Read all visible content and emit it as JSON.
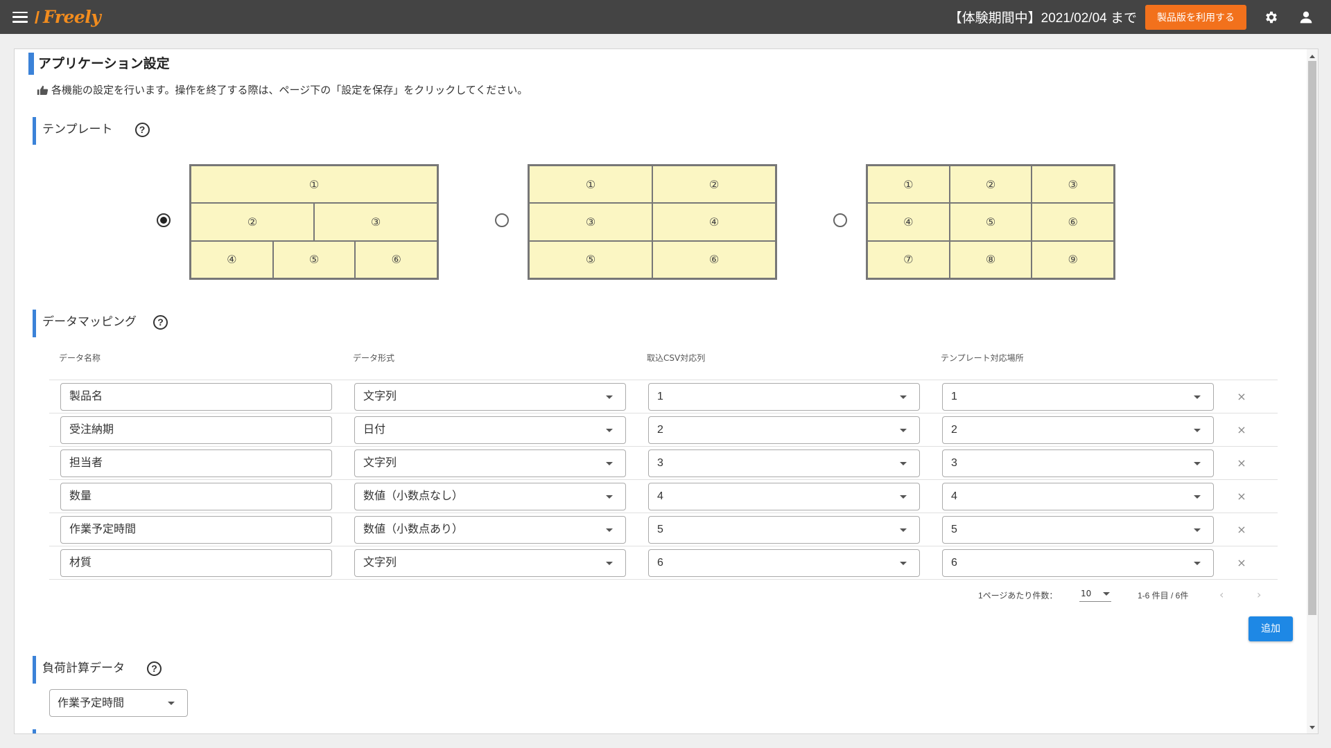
{
  "header": {
    "logo": "Freely",
    "trial_text": "【体験期間中】2021/02/04 まで",
    "buy_button": "製品版を利用する",
    "icons": [
      "menu-icon",
      "gear-icon",
      "user-icon"
    ]
  },
  "page": {
    "title": "アプリケーション設定",
    "description": "各機能の設定を行います。操作を終了する際は、ページ下の「設定を保存」をクリックしてください。"
  },
  "template_section": {
    "title": "テンプレート",
    "help": "?",
    "selected_index": 0,
    "options": [
      {
        "rows": [
          [
            "①"
          ],
          [
            "②",
            "③"
          ],
          [
            "④",
            "⑤",
            "⑥"
          ]
        ]
      },
      {
        "rows": [
          [
            "①",
            "②"
          ],
          [
            "③",
            "④"
          ],
          [
            "⑤",
            "⑥"
          ]
        ]
      },
      {
        "rows": [
          [
            "①",
            "②",
            "③"
          ],
          [
            "④",
            "⑤",
            "⑥"
          ],
          [
            "⑦",
            "⑧",
            "⑨"
          ]
        ]
      }
    ]
  },
  "mapping_section": {
    "title": "データマッピング",
    "help": "?",
    "columns": [
      "データ名称",
      "データ形式",
      "取込CSV対応列",
      "テンプレート対応場所"
    ],
    "rows": [
      {
        "name": "製品名",
        "format": "文字列",
        "csv_column": "1",
        "template_location": "1",
        "delete": "×"
      },
      {
        "name": "受注納期",
        "format": "日付",
        "csv_column": "2",
        "template_location": "2",
        "delete": "×"
      },
      {
        "name": "担当者",
        "format": "文字列",
        "csv_column": "3",
        "template_location": "3",
        "delete": "×"
      },
      {
        "name": "数量",
        "format": "数値（小数点なし）",
        "csv_column": "4",
        "template_location": "4",
        "delete": "×"
      },
      {
        "name": "作業予定時間",
        "format": "数値（小数点あり）",
        "csv_column": "5",
        "template_location": "5",
        "delete": "×"
      },
      {
        "name": "材質",
        "format": "文字列",
        "csv_column": "6",
        "template_location": "6",
        "delete": "×"
      }
    ],
    "pagination": {
      "per_page_label": "1ページあたり件数：",
      "per_page_value": "10",
      "range_text": "1-6 件目 / 6件",
      "prev": "‹",
      "next": "›"
    },
    "add_button": "追加"
  },
  "load_section": {
    "title": "負荷計算データ",
    "help": "?",
    "selected_value": "作業予定時間"
  }
}
